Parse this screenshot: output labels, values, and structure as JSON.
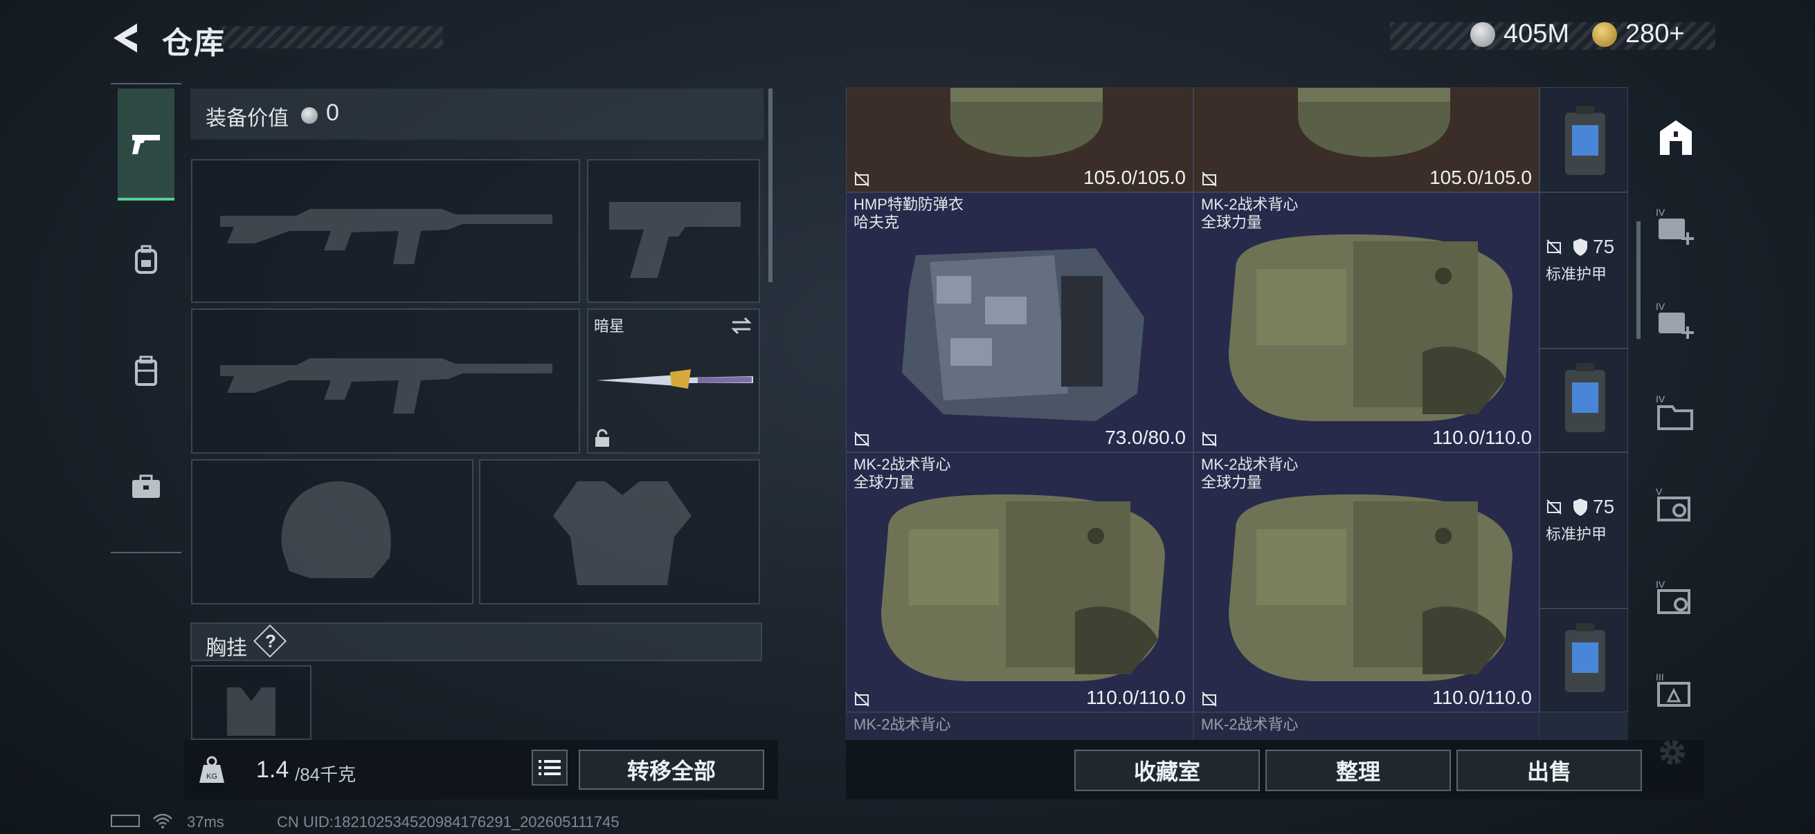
{
  "header": {
    "title": "仓库"
  },
  "currency": {
    "silver": "405M",
    "gold": "280+"
  },
  "equipment": {
    "value_label": "装备价值",
    "value": "0",
    "melee_name": "暗星",
    "chest_rig_label": "胸挂",
    "help": "?"
  },
  "capacity": {
    "current": "1.4",
    "max": "/84千克"
  },
  "buttons": {
    "transfer_all": "转移全部",
    "collection": "收藏室",
    "sort": "整理",
    "sell": "出售"
  },
  "grid": {
    "row0": [
      {
        "durability": "105.0/105.0"
      },
      {
        "durability": "105.0/105.0"
      }
    ],
    "row1": [
      {
        "name": "HMP特勤防弹衣",
        "sub": "哈夫克",
        "durability": "73.0/80.0"
      },
      {
        "name": "MK-2战术背心",
        "sub": "全球力量",
        "durability": "110.0/110.0"
      }
    ],
    "row2": [
      {
        "name": "MK-2战术背心",
        "sub": "全球力量",
        "durability": "110.0/110.0"
      },
      {
        "name": "MK-2战术背心",
        "sub": "全球力量",
        "durability": "110.0/110.0"
      }
    ],
    "row3": [
      {
        "name": "MK-2战术背心"
      },
      {
        "name": "MK-2战术背心"
      }
    ],
    "side_info": [
      {
        "armor": "75",
        "label": "标准护甲"
      },
      {
        "armor": "75",
        "label": "标准护甲"
      }
    ]
  },
  "status": {
    "ping": "37ms",
    "uid": "CN UID:182102534520984176291_202605111745"
  },
  "colors": {
    "accent_green": "#52d19a",
    "grid_cell": "#272a4a",
    "grid_brown": "#3b2e28"
  }
}
